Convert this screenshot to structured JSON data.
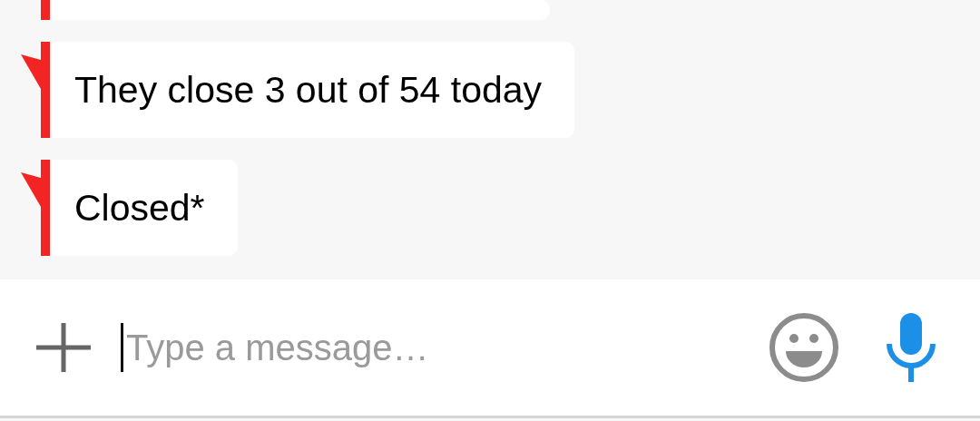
{
  "messages": [
    {
      "kind": "clipped"
    },
    {
      "kind": "text",
      "text": "They close 3 out of 54 today",
      "tail": true
    },
    {
      "kind": "text",
      "text": "Closed*",
      "tail": true
    }
  ],
  "composer": {
    "placeholder": "Type a message…"
  }
}
